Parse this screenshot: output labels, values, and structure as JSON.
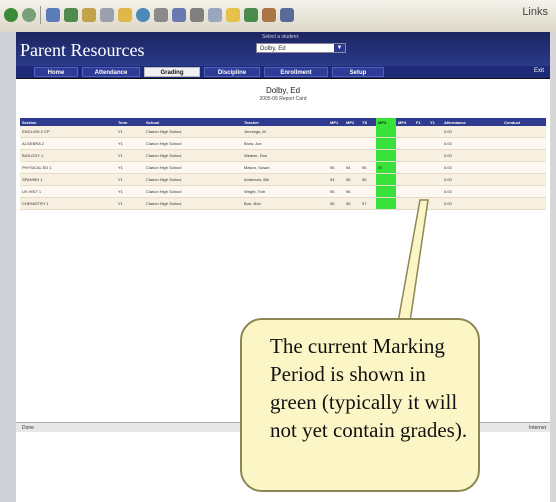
{
  "browser": {
    "right_label": "Links"
  },
  "page": {
    "brand": "Parent Resources",
    "student_selector_label": "Select a student:",
    "student_selector_value": "Dolby, Ed",
    "nav_tabs": [
      "Home",
      "Attendance",
      "Grading",
      "Discipline",
      "Enrollment",
      "Setup"
    ],
    "active_tab": "Grading",
    "nav_right": "Exit",
    "student_name": "Dolby, Ed",
    "report_title": "2005-06 Report Card"
  },
  "grade_table": {
    "columns": [
      "Section",
      "Term",
      "School",
      "Teacher",
      "MP1",
      "MP2",
      "TS",
      "MP3",
      "MP4",
      "F1",
      "Y1",
      "Attendance",
      "Conduct"
    ],
    "current_column": "MP3",
    "rows": [
      [
        "ENGLISH 2 CP",
        "Y1",
        "Clarion High School",
        "Jennings, M.",
        "",
        "",
        "",
        "",
        "",
        "",
        "",
        "0.00",
        ""
      ],
      [
        "ALGEBRA 2",
        "Y1",
        "Clarion High School",
        "Brow, Joe",
        "",
        "",
        "",
        "",
        "",
        "",
        "",
        "0.00",
        ""
      ],
      [
        "BIOLOGY 1",
        "Y1",
        "Clarion High School",
        "Weaver, Don",
        "",
        "",
        "",
        "",
        "",
        "",
        "",
        "0.00",
        ""
      ],
      [
        "PHYSICAL ED 1",
        "Y1",
        "Clarion High School",
        "Mason, Susan",
        "95",
        "94",
        "95",
        "95",
        "",
        "",
        "",
        "0.00",
        ""
      ],
      [
        "SPANISH 1",
        "Y1",
        "Clarion High School",
        "Anderson, Bill",
        "94",
        "96",
        "95",
        "",
        "",
        "",
        "",
        "0.00",
        ""
      ],
      [
        "US HIST 1",
        "Y1",
        "Clarion High School",
        "Wright, Tom",
        "95",
        "96",
        "",
        "",
        "",
        "",
        "",
        "0.00",
        ""
      ],
      [
        "CHEMISTRY 1",
        "Y1",
        "Clarion High School",
        "Burr, Bob",
        "96",
        "95",
        "97",
        "",
        "",
        "",
        "",
        "0.00",
        ""
      ]
    ]
  },
  "status": {
    "left": "Done",
    "right": "Internet"
  },
  "callout": {
    "text": "The current Marking Period is shown in green (typically it will not yet contain grades)."
  },
  "colors": {
    "header_navy": "#1c2560",
    "current_period_green": "#39e23a",
    "callout_fill": "#fcf6c6"
  }
}
